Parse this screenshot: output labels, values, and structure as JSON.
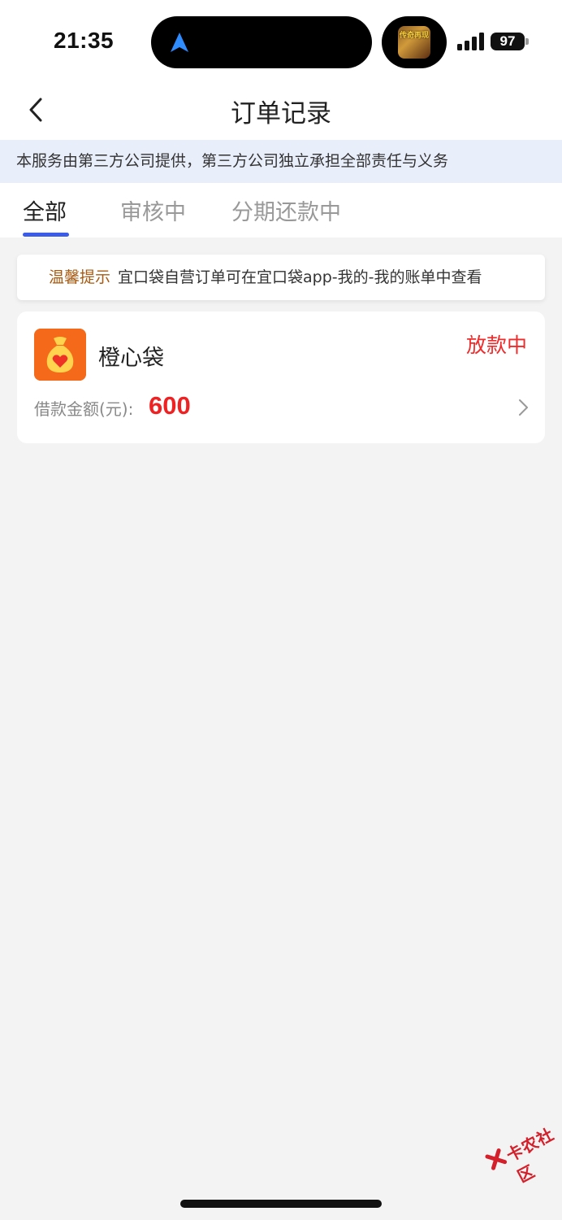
{
  "status_bar": {
    "time": "21:35",
    "battery": "97",
    "nav_icon": "navigation-arrow-icon",
    "game_icon_text": "传奇再现"
  },
  "nav": {
    "title": "订单记录",
    "back_icon": "chevron-left-icon"
  },
  "notice": {
    "text": "本服务由第三方公司提供，第三方公司独立承担全部责任与义务"
  },
  "tabs": [
    {
      "label": "全部",
      "active": true
    },
    {
      "label": "审核中",
      "active": false
    },
    {
      "label": "分期还款中",
      "active": false
    }
  ],
  "tip": {
    "label": "温馨提示",
    "text": "宜口袋自营订单可在宜口袋app-我的-我的账单中查看"
  },
  "orders": [
    {
      "name": "橙心袋",
      "status": "放款中",
      "amount_label": "借款金额(元):",
      "amount": "600"
    }
  ],
  "watermark": {
    "text": "卡农社区"
  },
  "colors": {
    "accent": "#3a5ce8",
    "status_red": "#ef2b2b",
    "tip_orange": "#a85a10",
    "notice_bg": "#e9eefb",
    "logo_orange": "#ff7a1a"
  }
}
